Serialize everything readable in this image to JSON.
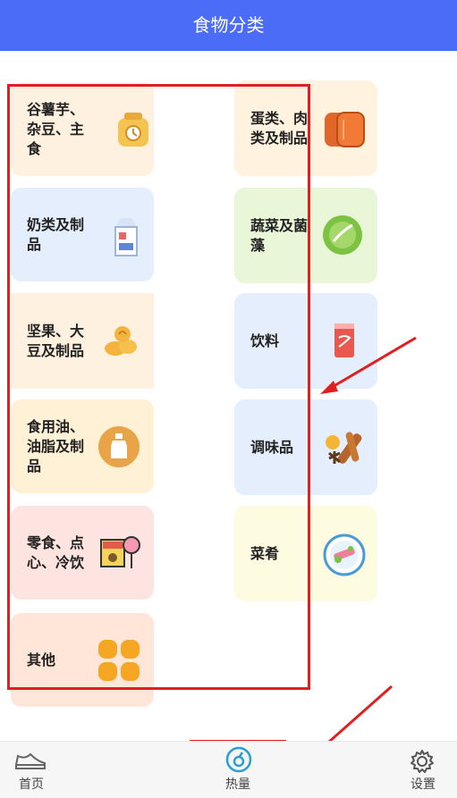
{
  "header": {
    "title": "食物分类"
  },
  "categories": {
    "grains": "谷薯芋、杂豆、主食",
    "eggs_meat": "蛋类、肉类及制品",
    "dairy": "奶类及制品",
    "vegetables": "蔬菜及菌藻",
    "nuts": "坚果、大豆及制品",
    "drinks": "饮料",
    "oils": "食用油、油脂及制品",
    "seasoning": "调味品",
    "snacks": "零食、点心、冷饮",
    "dishes": "菜肴",
    "others": "其他"
  },
  "icons": {
    "grains": "grain-bag-icon",
    "eggs_meat": "meat-icon",
    "dairy": "milk-carton-icon",
    "vegetables": "cabbage-icon",
    "nuts": "nuts-icon",
    "drinks": "cola-can-icon",
    "oils": "oil-bottle-icon",
    "seasoning": "spices-icon",
    "snacks": "snacks-icon",
    "dishes": "dish-plate-icon",
    "others": "four-dots-icon"
  },
  "bottom_nav": {
    "home": "首页",
    "calories": "热量",
    "settings": "设置"
  },
  "colors": {
    "header": "#4a6cf7",
    "annotation": "#e02020"
  }
}
